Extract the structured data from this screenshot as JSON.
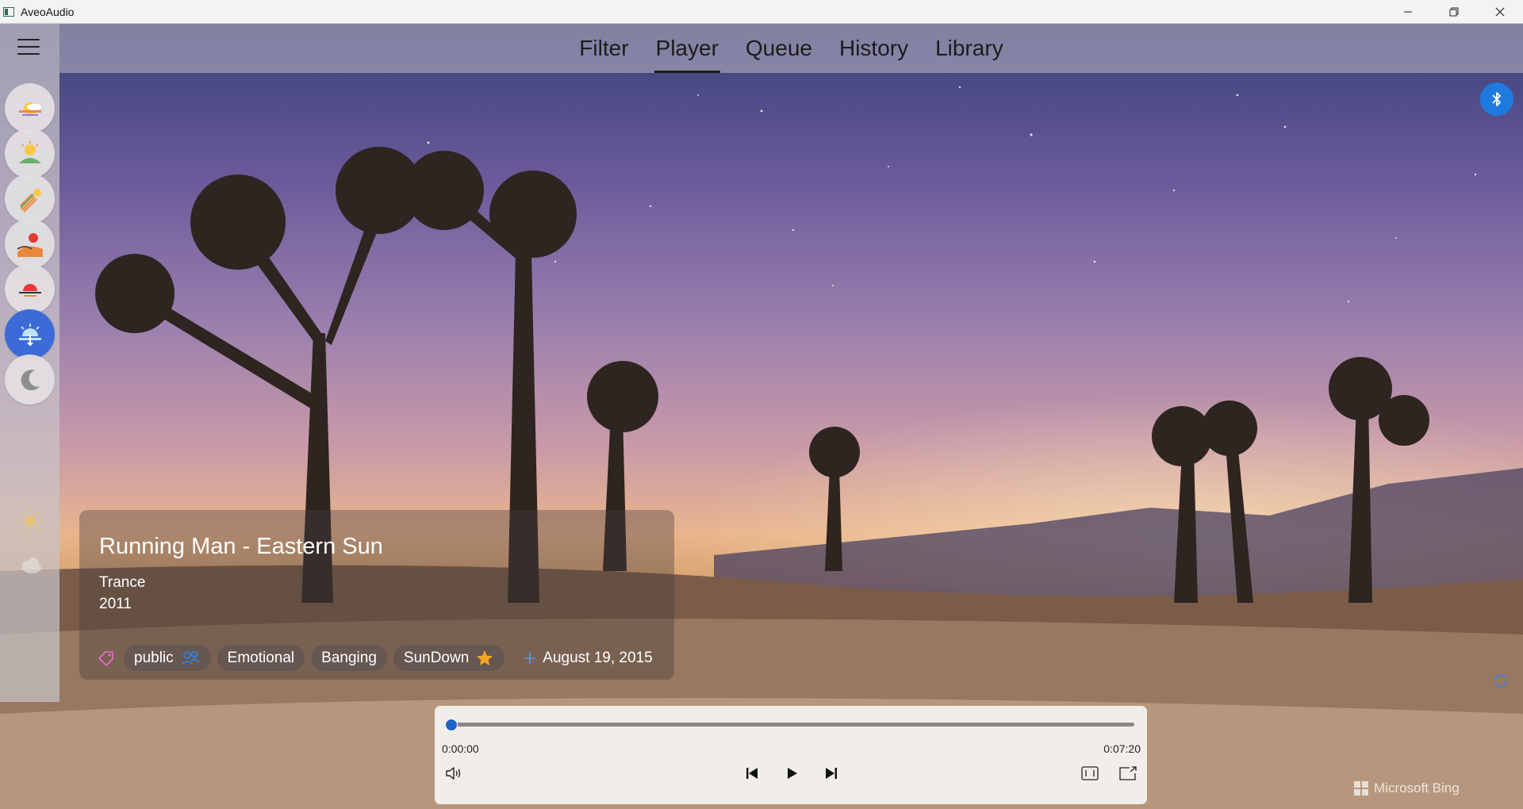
{
  "window": {
    "title": "AveoAudio",
    "controls": [
      "minimize-icon",
      "restore-icon",
      "close-icon"
    ]
  },
  "nav": {
    "tabs": [
      {
        "label": "Filter",
        "active": false
      },
      {
        "label": "Player",
        "active": true
      },
      {
        "label": "Queue",
        "active": false
      },
      {
        "label": "History",
        "active": false
      },
      {
        "label": "Library",
        "active": false
      }
    ]
  },
  "rail": {
    "items": [
      {
        "icon": "sunrise-cloudy-icon",
        "active": false
      },
      {
        "icon": "morning-sun-icon",
        "active": false
      },
      {
        "icon": "sun-rays-icon",
        "active": false
      },
      {
        "icon": "desert-sun-icon",
        "active": false
      },
      {
        "icon": "sunset-icon",
        "active": false
      },
      {
        "icon": "evening-cloud-icon",
        "active": true
      },
      {
        "icon": "moon-icon",
        "active": false
      },
      {
        "icon": "sunny-icon",
        "active": false,
        "faded": true
      },
      {
        "icon": "cloudy-icon",
        "active": false,
        "faded": true
      }
    ]
  },
  "track": {
    "title": "Running Man - Eastern Sun",
    "genre": "Trance",
    "year": "2011",
    "tags": [
      {
        "label": "public",
        "icon": "people-icon"
      },
      {
        "label": "Emotional"
      },
      {
        "label": "Banging"
      },
      {
        "label": "SunDown",
        "icon": "star-icon"
      }
    ],
    "added_date": "August 19, 2015"
  },
  "player": {
    "position": "0:00:00",
    "duration": "0:07:20",
    "progress": 0
  },
  "watermark": "Microsoft Bing",
  "colors": {
    "accent": "#1f64c8",
    "bluetooth": "#1f7ae0",
    "active_rail": "#3c6bd8",
    "star": "#f5a623"
  }
}
